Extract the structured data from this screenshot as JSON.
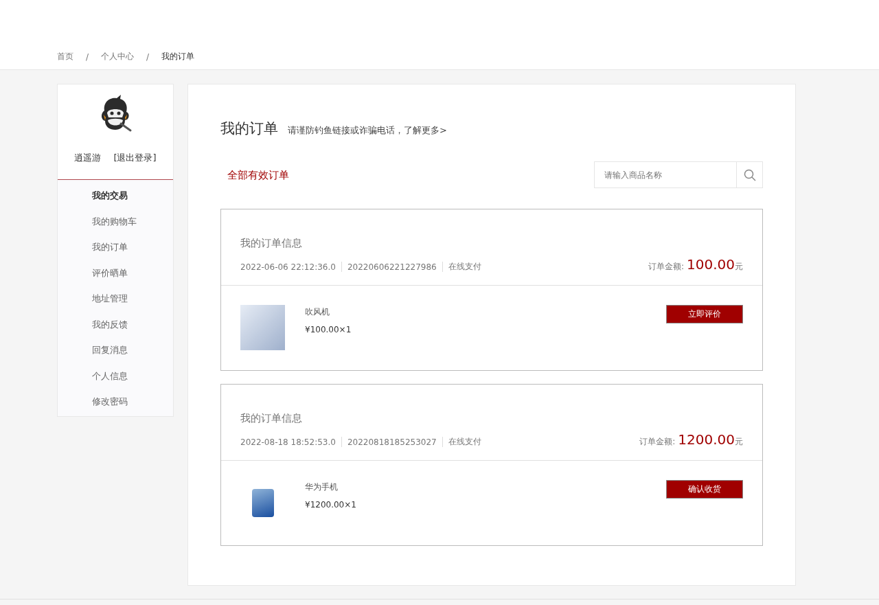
{
  "breadcrumb": [
    {
      "label": "首页",
      "separator": "/",
      "selected": false
    },
    {
      "label": "个人中心",
      "separator": "/",
      "selected": false
    },
    {
      "label": "我的订单",
      "selected": true
    }
  ],
  "sidebar": {
    "username": "逍遥游",
    "logout": "[退出登录]",
    "items": [
      {
        "label": "我的交易",
        "kind": "heading"
      },
      {
        "label": "我的购物车",
        "kind": "link"
      },
      {
        "label": "我的订单",
        "kind": "link"
      },
      {
        "label": "评价晒单",
        "kind": "link"
      },
      {
        "label": "地址管理",
        "kind": "link"
      },
      {
        "label": "我的反馈",
        "kind": "link"
      },
      {
        "label": "回复消息",
        "kind": "link"
      },
      {
        "label": "个人信息",
        "kind": "link"
      },
      {
        "label": "修改密码",
        "kind": "link"
      }
    ]
  },
  "main": {
    "title": "我的订单",
    "notice": "请谨防钓鱼链接或诈骗电话，了解更多>",
    "tabs": [
      {
        "label": "全部有效订单",
        "selected": true
      }
    ],
    "search": {
      "placeholder": "请输入商品名称"
    },
    "orders": [
      {
        "heading": "我的订单信息",
        "time": "2022-06-06 22:12:36.0",
        "number": "20220606221227986",
        "payment": "在线支付",
        "amount_label": "订单金额:",
        "amount": "100.00",
        "currency": "元",
        "product": {
          "kind": "dryer",
          "name": "吹风机",
          "price": "¥100.00×1"
        },
        "action": "立即评价"
      },
      {
        "heading": "我的订单信息",
        "time": "2022-08-18 18:52:53.0",
        "number": "20220818185253027",
        "payment": "在线支付",
        "amount_label": "订单金额:",
        "amount": "1200.00",
        "currency": "元",
        "product": {
          "kind": "phone",
          "name": "华为手机",
          "price": "¥1200.00×1"
        },
        "action": "确认收货"
      }
    ]
  }
}
